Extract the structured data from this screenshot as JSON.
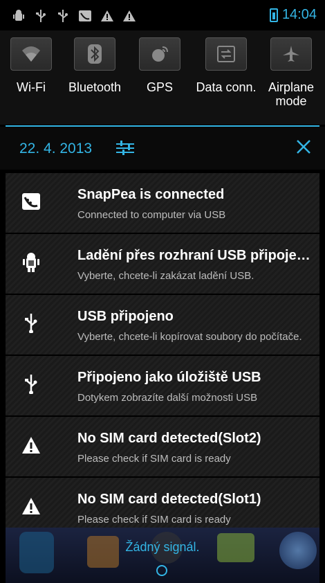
{
  "status_bar": {
    "icons": [
      "android-debug-icon",
      "usb-icon",
      "usb-icon",
      "snappea-icon",
      "warning-icon",
      "warning-icon"
    ],
    "time": "14:04"
  },
  "quick_toggles": [
    {
      "label": "Wi-Fi",
      "icon": "wifi-icon"
    },
    {
      "label": "Bluetooth",
      "icon": "bluetooth-icon"
    },
    {
      "label": "GPS",
      "icon": "gps-icon"
    },
    {
      "label": "Data conn.",
      "icon": "data-connection-icon"
    },
    {
      "label": "Airplane mode",
      "icon": "airplane-icon"
    }
  ],
  "header": {
    "date": "22. 4. 2013"
  },
  "notifications": [
    {
      "icon": "snappea-icon",
      "title": "SnapPea is connected",
      "subtitle": "Connected to computer via USB"
    },
    {
      "icon": "android-debug-icon",
      "title": "Ladění přes rozhraní USB připojeno",
      "subtitle": "Vyberte, chcete-li zakázat ladění USB."
    },
    {
      "icon": "usb-icon",
      "title": "USB připojeno",
      "subtitle": "Vyberte, chcete-li kopírovat soubory do počítače."
    },
    {
      "icon": "usb-icon",
      "title": "Připojeno jako úložiště USB",
      "subtitle": "Dotykem zobrazíte další možnosti USB"
    },
    {
      "icon": "warning-icon",
      "title": "No SIM card detected(Slot2)",
      "subtitle": "Please check if SIM card is ready"
    },
    {
      "icon": "warning-icon",
      "title": "No SIM card detected(Slot1)",
      "subtitle": "Please check if SIM card is ready"
    }
  ],
  "footer": {
    "carrier_status": "Žádný signál."
  },
  "colors": {
    "accent": "#33b5e5"
  }
}
